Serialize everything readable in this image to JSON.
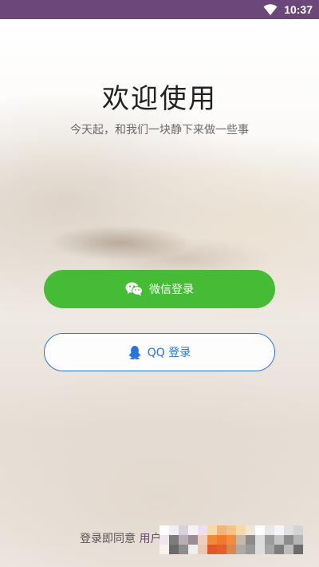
{
  "status_bar": {
    "time": "10:37",
    "icons": [
      "wifi-icon"
    ],
    "background": "#6b477a"
  },
  "welcome": {
    "title": "欢迎使用",
    "subtitle": "今天起，和我们一块静下来做一些事"
  },
  "buttons": {
    "wechat_label": "微信登录",
    "wechat_icon": "wechat-icon",
    "wechat_color": "#45bb36",
    "qq_label": "QQ 登录",
    "qq_icon": "qq-icon",
    "qq_color": "#2a74d8"
  },
  "agreement": {
    "prefix": "登录即同意 ",
    "link_visible": "用户",
    "redacted": true
  }
}
